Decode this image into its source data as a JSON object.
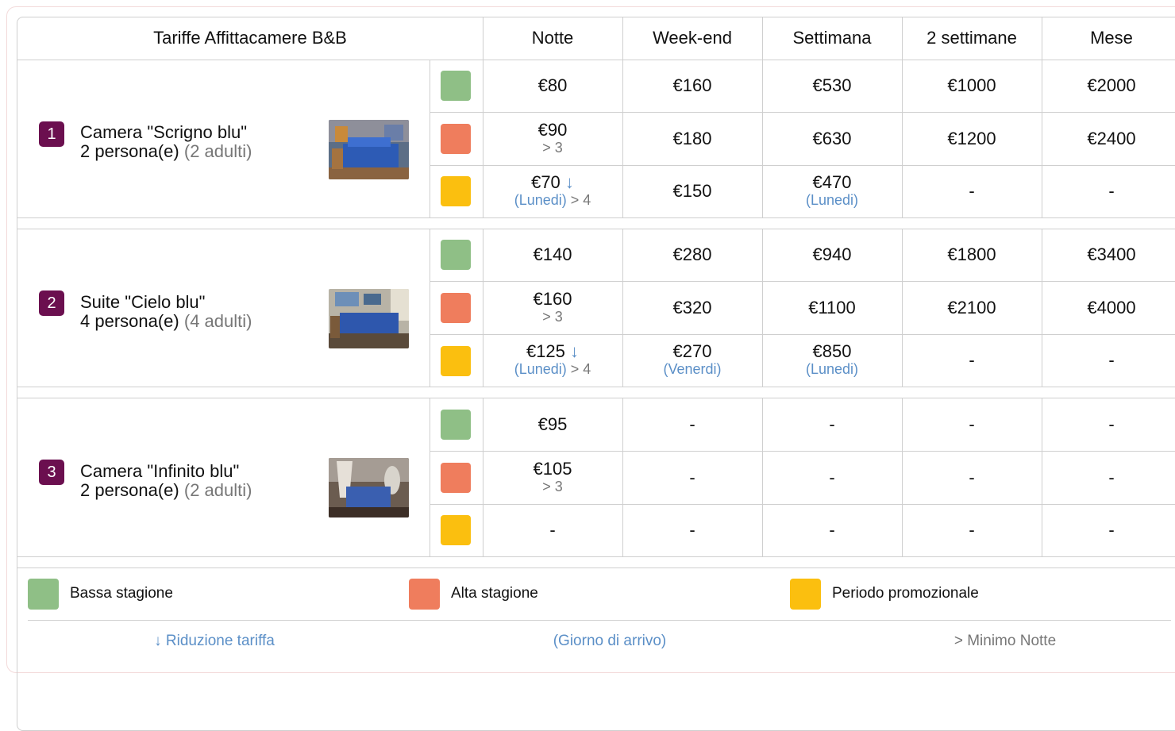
{
  "table": {
    "title": "Tariffe Affittacamere B&B",
    "columns": [
      "Notte",
      "Week-end",
      "Settimana",
      "2 settimane",
      "Mese"
    ]
  },
  "colors": {
    "bassa": "#8fbf86",
    "alta": "#ef7d5d",
    "promo": "#fbbf0f",
    "badge": "#6b0f4f",
    "link": "#5b8fc7"
  },
  "rooms": [
    {
      "number": "1",
      "name": "Camera \"Scrigno blu\"",
      "capacity": "2 persona(e)",
      "adults": "(2 adulti)",
      "photo_icon": "bedroom-photo",
      "rates": {
        "bassa": [
          "€80",
          "€160",
          "€530",
          "€1000",
          "€2000"
        ],
        "alta": [
          "€90",
          "€180",
          "€630",
          "€1200",
          "€2400"
        ],
        "alta_min": "> 3",
        "promo": [
          "€70",
          "€150",
          "€470",
          "-",
          "-"
        ],
        "promo_arrow": "↓",
        "promo_day": "(Lunedi)",
        "promo_min": "> 4",
        "promo_week_day": "(Lunedi)"
      }
    },
    {
      "number": "2",
      "name": "Suite \"Cielo blu\"",
      "capacity": "4 persona(e)",
      "adults": "(4 adulti)",
      "photo_icon": "suite-photo",
      "rates": {
        "bassa": [
          "€140",
          "€280",
          "€940",
          "€1800",
          "€3400"
        ],
        "alta": [
          "€160",
          "€320",
          "€1100",
          "€2100",
          "€4000"
        ],
        "alta_min": "> 3",
        "promo": [
          "€125",
          "€270",
          "€850",
          "-",
          "-"
        ],
        "promo_arrow": "↓",
        "promo_day": "(Lunedi)",
        "promo_min": "> 4",
        "promo_weekend_day": "(Venerdi)",
        "promo_week_day": "(Lunedi)"
      }
    },
    {
      "number": "3",
      "name": "Camera \"Infinito blu\"",
      "capacity": "2 persona(e)",
      "adults": "(2 adulti)",
      "photo_icon": "canopy-bed-photo",
      "rates": {
        "bassa": [
          "€95",
          "-",
          "-",
          "-",
          "-"
        ],
        "alta": [
          "€105",
          "-",
          "-",
          "-",
          "-"
        ],
        "alta_min": "> 3",
        "promo": [
          "-",
          "-",
          "-",
          "-",
          "-"
        ]
      }
    }
  ],
  "legend": {
    "bassa": "Bassa stagione",
    "alta": "Alta stagione",
    "promo": "Periodo promozionale"
  },
  "footer": {
    "reduction": "↓ Riduzione tariffa",
    "arrival": "(Giorno di arrivo)",
    "min_nights": "> Minimo Notte"
  }
}
